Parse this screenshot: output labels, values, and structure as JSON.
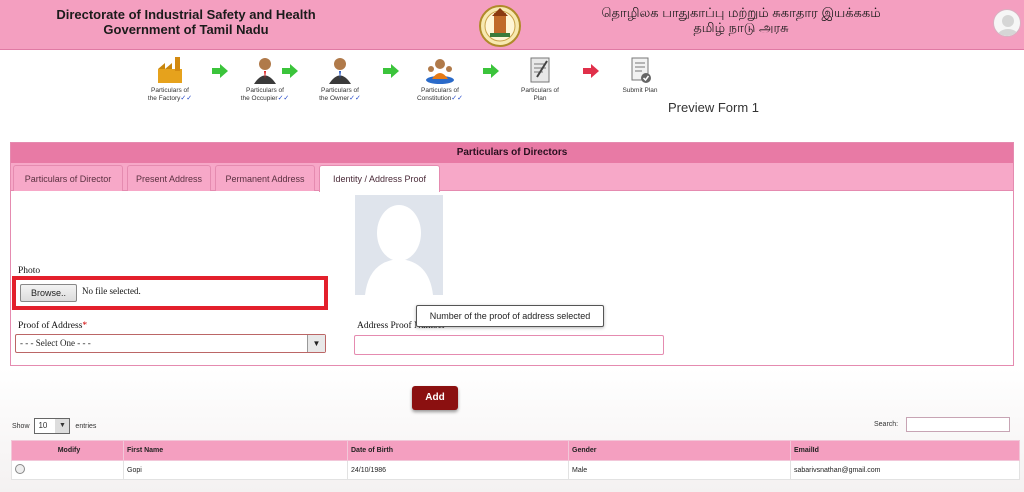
{
  "header": {
    "title_en_line1": "Directorate of Industrial Safety and Health",
    "title_en_line2": "Government of Tamil Nadu",
    "title_ta_line1": "தொழிலக பாதுகாப்பு மற்றும் சுகாதார இயக்ககம்",
    "title_ta_line2": "தமிழ் நாடு அரசு",
    "emblem_icon": "tamil-nadu-emblem",
    "avatar_icon": "user-avatar-icon"
  },
  "wizard": {
    "steps": [
      {
        "label1": "Particulars of",
        "label2": "the Factory",
        "done": "✓✓",
        "icon": "factory-icon"
      },
      {
        "label1": "Particulars of",
        "label2": "the Occupier",
        "done": "✓✓",
        "icon": "person-icon"
      },
      {
        "label1": "Particulars of",
        "label2": "the Owner",
        "done": "✓✓",
        "icon": "person-icon"
      },
      {
        "label1": "Particulars of",
        "label2": "Constitution",
        "done": "✓✓",
        "icon": "organization-icon"
      },
      {
        "label1": "Particulars of",
        "label2": "Plan",
        "done": "",
        "icon": "plan-icon"
      },
      {
        "label1": "Submit Plan",
        "label2": "",
        "done": "",
        "icon": "submit-icon"
      }
    ],
    "preview_label": "Preview Form 1"
  },
  "panel": {
    "title": "Particulars of Directors",
    "tabs": [
      {
        "label": "Particulars of Director",
        "active": false
      },
      {
        "label": "Present Address",
        "active": false
      },
      {
        "label": "Permanent Address",
        "active": false
      },
      {
        "label": "Identity / Address Proof",
        "active": true
      }
    ],
    "photo_label": "Photo",
    "browse_label": "Browse..",
    "no_file_text": "No file selected.",
    "proof_label": "Proof of Address",
    "required_mark": "*",
    "proof_selected": "- - - Select One - - -",
    "address_proof_number_label": "Address Proof Number",
    "tooltip_text": "Number of the proof of address selected"
  },
  "add_button": "Add",
  "table_controls": {
    "show_label": "Show",
    "entries_value": "10",
    "entries_label": "entries",
    "search_label": "Search:"
  },
  "table": {
    "columns": [
      "Modify",
      "First Name",
      "Date of Birth",
      "Gender",
      "EmailId"
    ],
    "rows": [
      {
        "first_name": "Gopi",
        "dob": "24/10/1986",
        "gender": "Male",
        "email": "sabarivsnathan@gmail.com"
      }
    ]
  },
  "colors": {
    "header_pink": "#f49fc0",
    "panel_title": "#e87aa5",
    "highlight_red": "#e3202c",
    "add_button": "#8b1010"
  }
}
